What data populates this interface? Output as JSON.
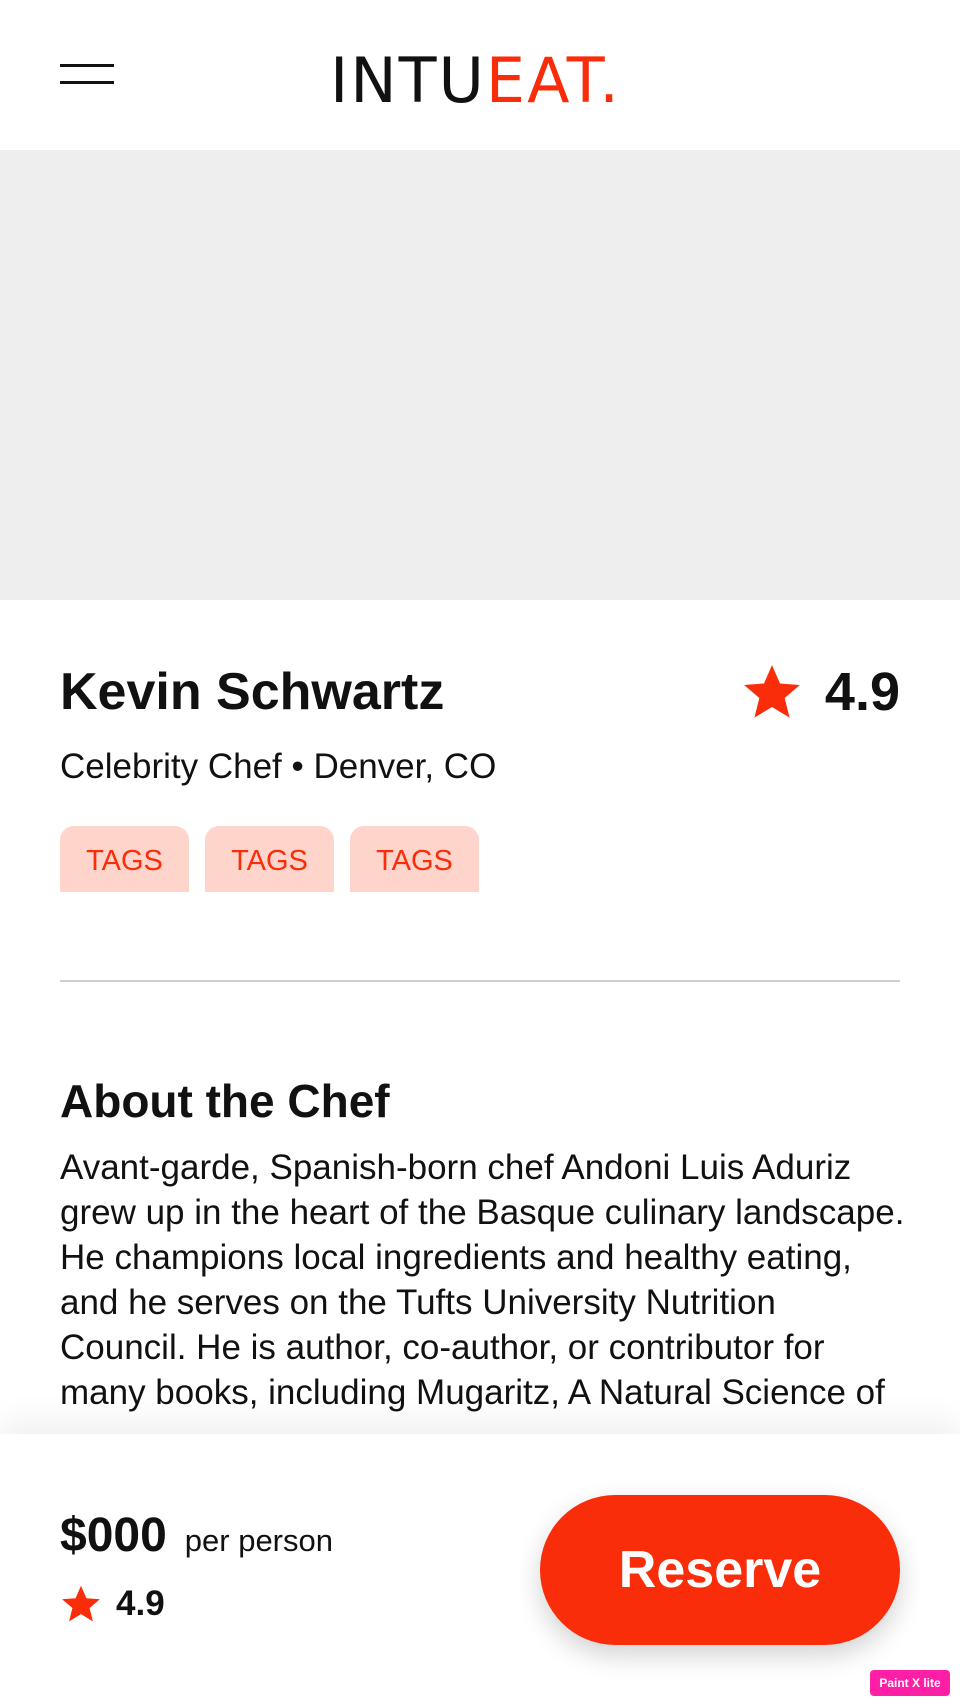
{
  "header": {
    "logo_dark": "INTU",
    "logo_accent": "EAT."
  },
  "chef": {
    "name": "Kevin Schwartz",
    "rating": "4.9",
    "subtitle": "Celebrity Chef • Denver, CO",
    "tags": [
      "TAGS",
      "TAGS",
      "TAGS"
    ]
  },
  "about": {
    "title": "About the Chef",
    "text": "Avant-garde, Spanish-born chef Andoni Luis Aduriz grew up in the heart of the Basque culinary landscape. He champions local ingredients and healthy eating, and he serves on the Tufts University Nutrition Council. He is author, co-author, or contributor for many books, including Mugaritz, A Natural Science of"
  },
  "booking": {
    "price": "$000",
    "price_unit": "per person",
    "rating": "4.9",
    "reserve_label": "Reserve"
  },
  "watermark": "Paint X lite",
  "colors": {
    "accent": "#fa2d0a",
    "tag_bg": "#ffd5cb",
    "hero_placeholder": "#eeeeee",
    "text": "#111111"
  },
  "icons": {
    "menu": "hamburger-menu-icon",
    "rating": "star-icon"
  }
}
